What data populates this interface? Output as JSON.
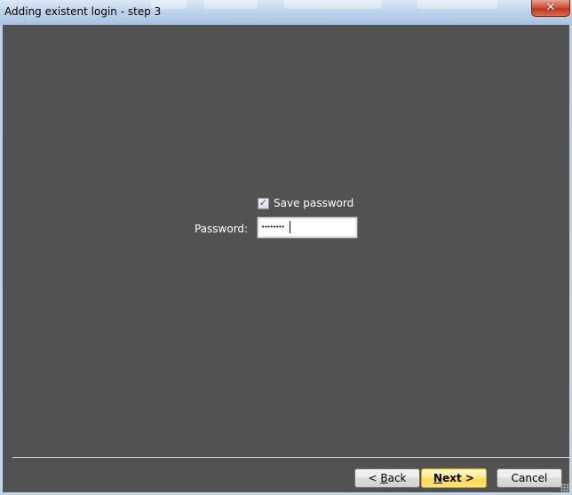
{
  "window": {
    "title": "Adding existent login - step 3"
  },
  "form": {
    "save_password_label": "Save password",
    "save_password_checked": true,
    "password_label": "Password:",
    "password_value": "••••••••"
  },
  "buttons": {
    "back_prefix": "< ",
    "back_accel": "B",
    "back_rest": "ack",
    "next_accel": "N",
    "next_rest": "ext >",
    "cancel": "Cancel"
  },
  "icons": {
    "close": "close-icon",
    "check": "checkmark-icon",
    "grip": "resize-grip-icon"
  },
  "colors": {
    "client_bg": "#525252",
    "default_button": "#ffe27a"
  }
}
